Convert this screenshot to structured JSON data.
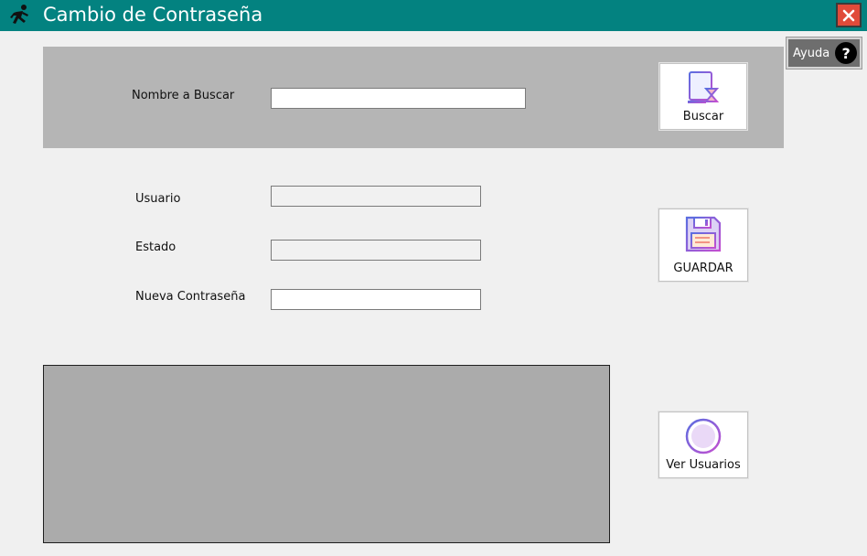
{
  "window": {
    "title": "Cambio de Contraseña",
    "close_label": "✕",
    "help_label": "Ayuda",
    "help_icon": "?"
  },
  "search": {
    "label": "Nombre a Buscar",
    "value": "",
    "button_label": "Buscar"
  },
  "form": {
    "usuario_label": "Usuario",
    "usuario_value": "",
    "estado_label": "Estado",
    "estado_value": "",
    "password_label": "Nueva Contraseña",
    "password_value": "",
    "save_label": "GUARDAR"
  },
  "users": {
    "view_label": "Ver Usuarios"
  },
  "colors": {
    "titlebar": "#038280",
    "panel": "#b5b5b5",
    "grid": "#ababab",
    "close": "#e04b3a"
  }
}
